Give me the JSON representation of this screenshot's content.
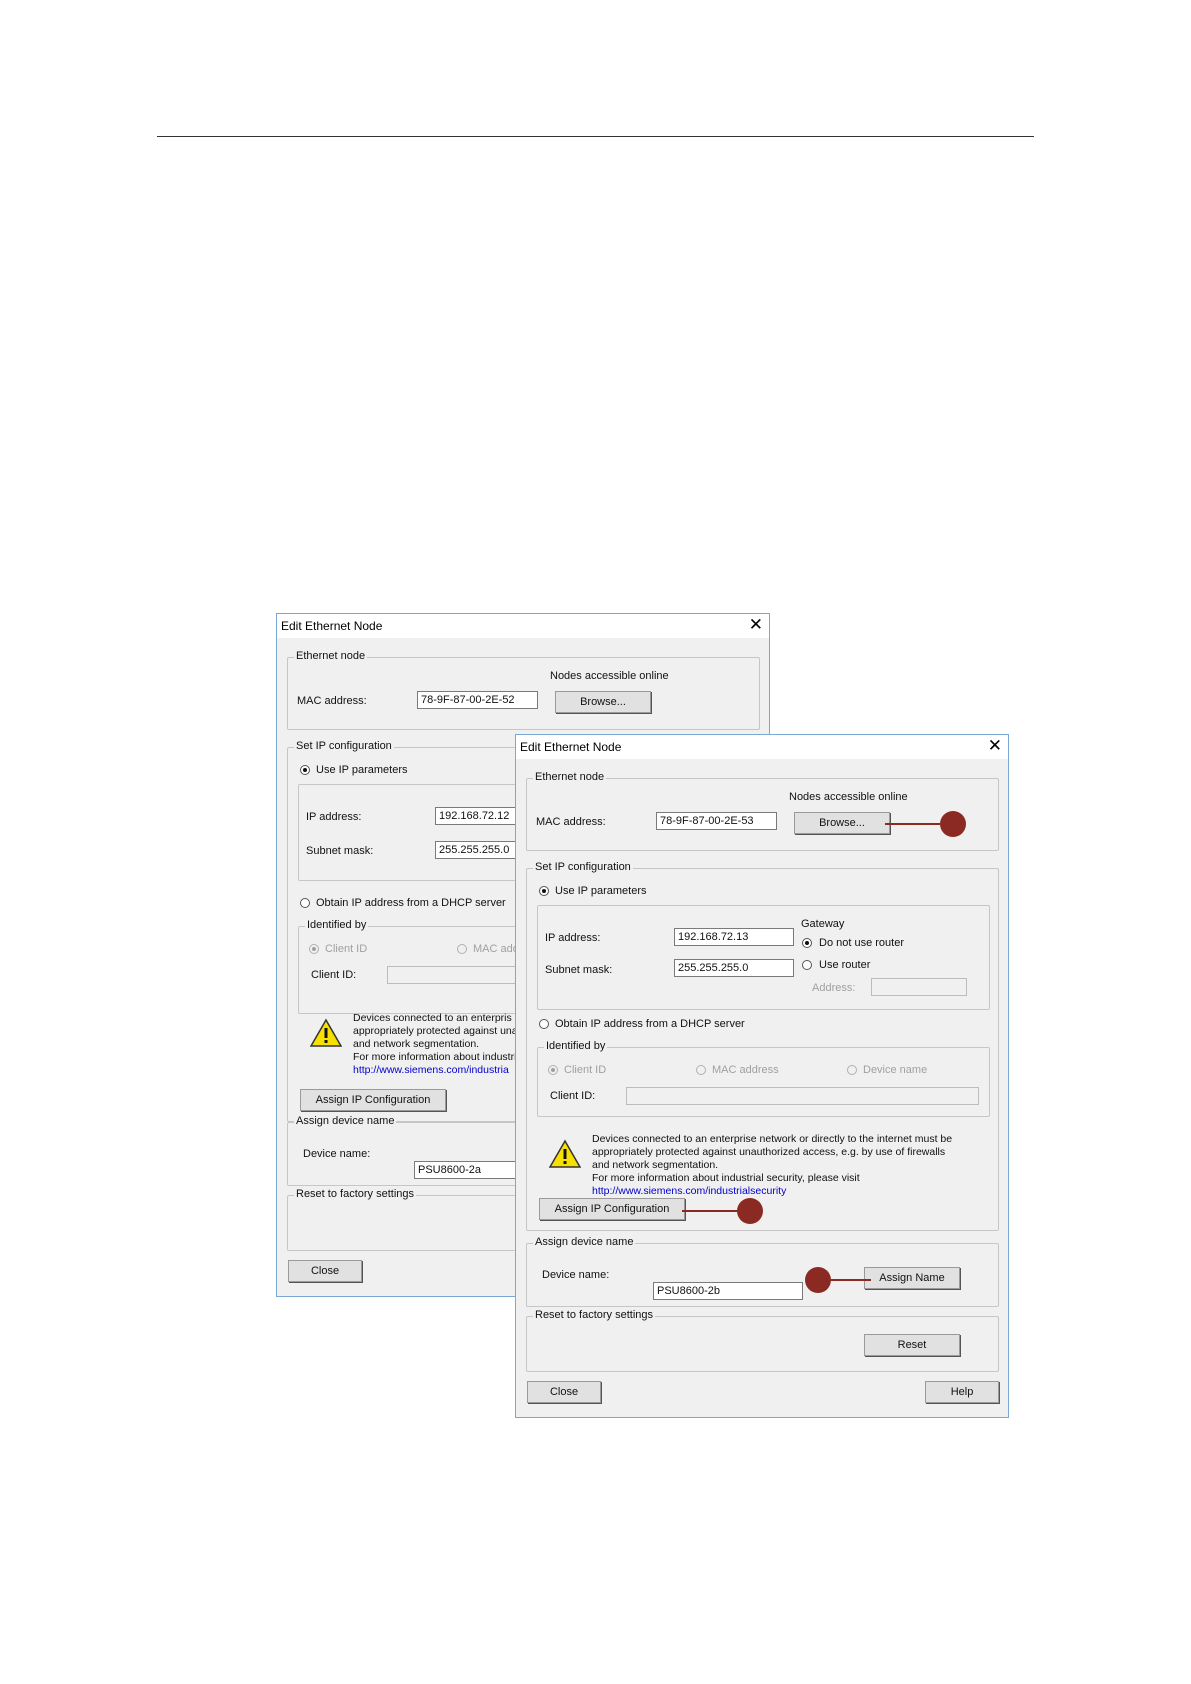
{
  "dialog_back": {
    "title": "Edit Ethernet Node",
    "ethernet_node_group": "Ethernet node",
    "mac_label": "MAC address:",
    "mac_value": "78-9F-87-00-2E-52",
    "nodes_label": "Nodes accessible online",
    "browse_label": "Browse...",
    "set_ip_group": "Set IP configuration",
    "use_ip_label": "Use IP parameters",
    "ip_label": "IP address:",
    "ip_value": "192.168.72.12",
    "subnet_label": "Subnet mask:",
    "subnet_value": "255.255.255.0",
    "dhcp_label": "Obtain IP address from a DHCP server",
    "identified_by": "Identified by",
    "client_id_radio": "Client ID",
    "mac_radio": "MAC ado",
    "client_id_label": "Client ID:",
    "warning_lines": [
      "Devices connected to an enterpris",
      "appropriately protected against una",
      "and network segmentation.",
      "For more information about industria"
    ],
    "warning_link": "http://www.siemens.com/industria",
    "assign_ip_label": "Assign IP Configuration",
    "assign_name_group": "Assign device name",
    "device_name_label": "Device name:",
    "device_name_value": "PSU8600-2a",
    "reset_group": "Reset to factory settings",
    "close_label": "Close"
  },
  "dialog_front": {
    "title": "Edit Ethernet Node",
    "ethernet_node_group": "Ethernet node",
    "mac_label": "MAC address:",
    "mac_value": "78-9F-87-00-2E-53",
    "nodes_label": "Nodes accessible online",
    "browse_label": "Browse...",
    "set_ip_group": "Set IP configuration",
    "use_ip_label": "Use IP parameters",
    "ip_label": "IP address:",
    "ip_value": "192.168.72.13",
    "subnet_label": "Subnet mask:",
    "subnet_value": "255.255.255.0",
    "gateway_label": "Gateway",
    "no_router_label": "Do not use router",
    "use_router_label": "Use router",
    "address_label": "Address:",
    "dhcp_label": "Obtain IP address from a DHCP server",
    "identified_by": "Identified by",
    "client_id_radio": "Client ID",
    "mac_radio": "MAC address",
    "device_name_radio": "Device name",
    "client_id_label": "Client ID:",
    "warning_lines": [
      "Devices connected to an enterprise network or directly to the internet must be",
      "appropriately protected against unauthorized access, e.g. by use of firewalls",
      "and network segmentation.",
      "For more information about industrial security, please visit"
    ],
    "warning_link": "http://www.siemens.com/industrialsecurity",
    "assign_ip_label": "Assign IP Configuration",
    "assign_name_group": "Assign device name",
    "device_name_label": "Device name:",
    "device_name_value": "PSU8600-2b",
    "assign_name_label": "Assign Name",
    "reset_group": "Reset to factory settings",
    "reset_label": "Reset",
    "close_label": "Close",
    "help_label": "Help"
  },
  "colors": {
    "callout": "#8b2a22",
    "dialog_bg": "#f0f0f0",
    "dialog_border": "#7aa7d6",
    "link": "#0000cc"
  },
  "icons": [
    "close-icon",
    "warning-icon",
    "callout-marker"
  ]
}
